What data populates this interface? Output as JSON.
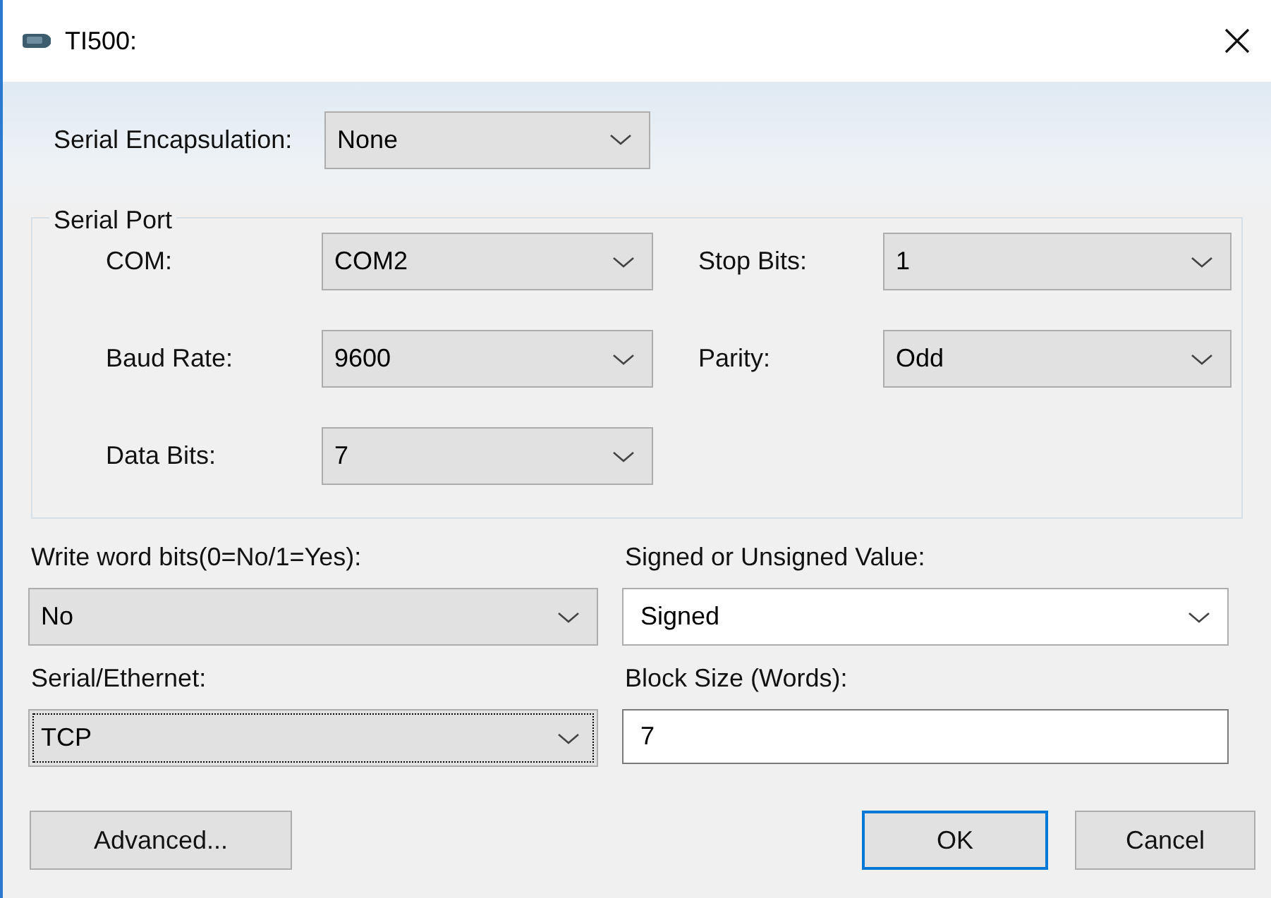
{
  "window": {
    "title": "TI500:"
  },
  "encapsulation": {
    "label": "Serial Encapsulation:",
    "field": {
      "kind": "dropdown",
      "value": "None",
      "focused": false
    }
  },
  "serial_port": {
    "title": "Serial Port",
    "left": [
      {
        "label": "COM:",
        "field": {
          "kind": "dropdown",
          "value": "COM2",
          "focused": false
        }
      },
      {
        "label": "Baud Rate:",
        "field": {
          "kind": "dropdown",
          "value": "9600",
          "focused": false
        }
      },
      {
        "label": "Data Bits:",
        "field": {
          "kind": "dropdown",
          "value": "7",
          "focused": false
        }
      }
    ],
    "right": [
      {
        "label": "Stop Bits:",
        "field": {
          "kind": "dropdown",
          "value": "1",
          "focused": false
        }
      },
      {
        "label": "Parity:",
        "field": {
          "kind": "dropdown",
          "value": "Odd",
          "focused": false
        }
      }
    ]
  },
  "options": [
    {
      "label": "Write word bits(0=No/1=Yes):",
      "field": {
        "kind": "dropdown",
        "value": "No",
        "focused": false
      }
    },
    {
      "label": "Signed or Unsigned Value:",
      "field": {
        "kind": "combobox",
        "value": "Signed",
        "focused": false
      }
    },
    {
      "label": "Serial/Ethernet:",
      "field": {
        "kind": "dropdown",
        "value": "TCP",
        "focused": true
      }
    },
    {
      "label": "Block Size (Words):",
      "field": {
        "kind": "textbox",
        "value": "7",
        "focused": false
      }
    }
  ],
  "buttons": [
    {
      "label": "Advanced...",
      "default": false
    },
    {
      "label": "OK",
      "default": true
    },
    {
      "label": "Cancel",
      "default": false
    }
  ]
}
